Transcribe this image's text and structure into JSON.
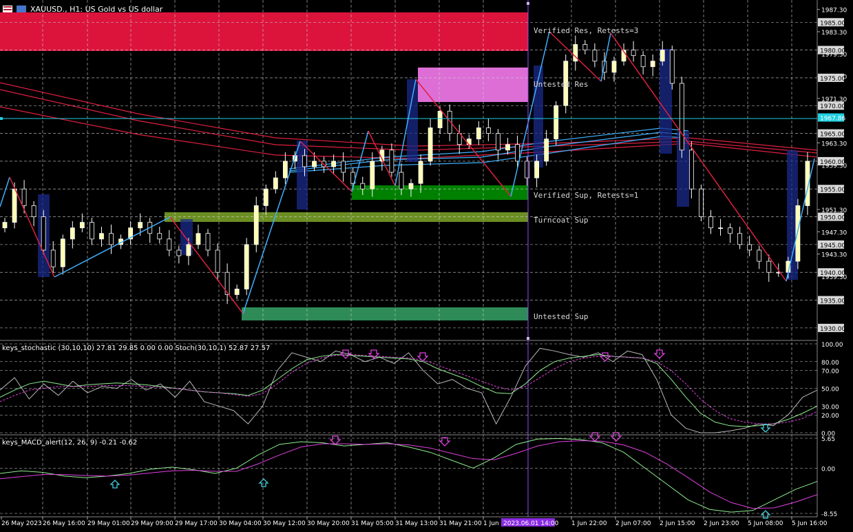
{
  "window": {
    "symbol_title": "XAUUSD., H1:  US Gold vs US dollar",
    "colors": {
      "background": "#000000",
      "bull": "#ffffb4",
      "bear": "#ffffff",
      "grid": "#cfcfcf"
    }
  },
  "zones": [
    {
      "label": "Verified Res, Retests=3",
      "color": "#dc143c"
    },
    {
      "label": "Untested Res",
      "color": "#dd6ed6"
    },
    {
      "label": "Verified Sup, Retests=1",
      "color": "#008000"
    },
    {
      "label": "Turncoat Sup",
      "color": "#6b8e23"
    },
    {
      "label": "Untested Sup",
      "color": "#2e8b57"
    }
  ],
  "price_axis": {
    "labels": [
      "1987.30",
      "1983.30",
      "1979.30",
      "1975.30",
      "1971.30",
      "1963.30",
      "1959.30",
      "1951.30",
      "1947.30",
      "1943.30",
      "1939.30"
    ],
    "tags": [
      "1985.00",
      "1980.00",
      "1975.00",
      "1970.00",
      "1965.00",
      "1960.00",
      "1955.00",
      "1950.00",
      "1945.00",
      "1940.00",
      "1935.00",
      "1930.00"
    ],
    "current_price": "1967.86",
    "current_color": "#20d0e0"
  },
  "stoch_panel": {
    "title": "keys_stochastic (30,10,10) 27.81 29.85 0.00 0.00 Stoch(30,10,1) 52.87 27.57",
    "levels": [
      "100.00",
      "80.00",
      "70.00",
      "50.00",
      "30.00",
      "20.00",
      "0.00"
    ]
  },
  "macd_panel": {
    "title": "keys_MACD_alert(12, 26, 9) -0.21 -0.62",
    "levels": [
      "5.65",
      "0.00",
      "-8.55"
    ]
  },
  "time_axis": {
    "labels": [
      "26 May 2023",
      "26 May 16:00",
      "29 May 01:00",
      "29 May 09:00",
      "29 May 17:00",
      "30 May 04:00",
      "30 May 12:00",
      "30 May 20:00",
      "31 May 05:00",
      "31 May 13:00",
      "31 May 21:00",
      "1 Jun",
      "1 Jun 22:00",
      "2 Jun 07:00",
      "2 Jun 15:00",
      "2 Jun 23:00",
      "5 Jun 08:00",
      "5 Jun 16:00"
    ],
    "crosshair_time": "2023.06.01 14:00"
  },
  "chart_data": {
    "type": "candlestick",
    "symbol": "XAUUSD.",
    "timeframe": "H1",
    "ylim": [
      1928,
      1989
    ],
    "closes_approx": [
      1949,
      1955,
      1952,
      1950,
      1944,
      1941,
      1946,
      1948,
      1949,
      1946,
      1947,
      1945,
      1946,
      1948,
      1949,
      1947,
      1946,
      1944,
      1943,
      1945,
      1947,
      1944,
      1940,
      1936,
      1937,
      1945,
      1952,
      1955,
      1957,
      1960,
      1961,
      1959,
      1960,
      1959,
      1960,
      1958,
      1956,
      1955,
      1960,
      1962,
      1958,
      1955,
      1956,
      1960,
      1966,
      1969,
      1965,
      1963,
      1964,
      1966,
      1965,
      1962,
      1963,
      1960,
      1957,
      1960,
      1964,
      1970,
      1978,
      1981,
      1980,
      1978,
      1976,
      1978,
      1980,
      1979,
      1977,
      1978,
      1980,
      1974,
      1962,
      1955,
      1950,
      1948,
      1948,
      1947,
      1945,
      1944,
      1942,
      1940,
      1940,
      1942,
      1952,
      1960
    ]
  }
}
